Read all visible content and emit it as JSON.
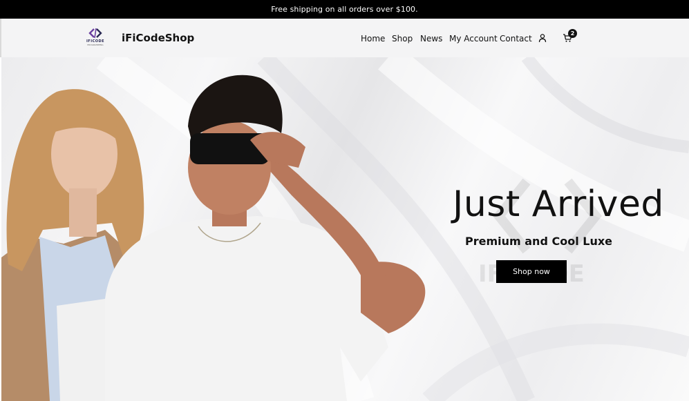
{
  "announcement": {
    "text": "Free shipping on all orders over $100."
  },
  "header": {
    "logo": {
      "text": "IFICODE",
      "subtext": "PROGRAMMING"
    },
    "brand": "iFiCodeShop",
    "nav": [
      "Home",
      "Shop",
      "News",
      "My Account",
      "Contact"
    ],
    "account_icon": "user-icon",
    "cart_icon": "cart-icon",
    "cart_count": "2"
  },
  "hero": {
    "title": "Just Arrived",
    "subtitle": "Premium and Cool Luxe",
    "button": "Shop now"
  },
  "colors": {
    "topbar": "#000000",
    "header_bg": "#f4f4f5",
    "button_bg": "#000000",
    "logo_accent": "#6a3fa0"
  }
}
